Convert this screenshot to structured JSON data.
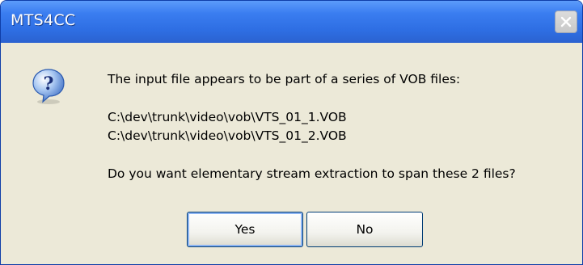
{
  "window": {
    "title": "MTS4CC"
  },
  "dialog": {
    "icon": "question-icon",
    "message_line1": "The input file appears to be part of a series of VOB files:",
    "file1": "C:\\dev\\trunk\\video\\vob\\VTS_01_1.VOB",
    "file2": "C:\\dev\\trunk\\video\\vob\\VTS_01_2.VOB",
    "question": "Do you want elementary stream extraction to span these 2 files?"
  },
  "buttons": {
    "yes_label": "Yes",
    "no_label": "No"
  },
  "colors": {
    "titlebar": "#2e6ee3",
    "face": "#ece9d8",
    "button_border": "#003c74"
  }
}
